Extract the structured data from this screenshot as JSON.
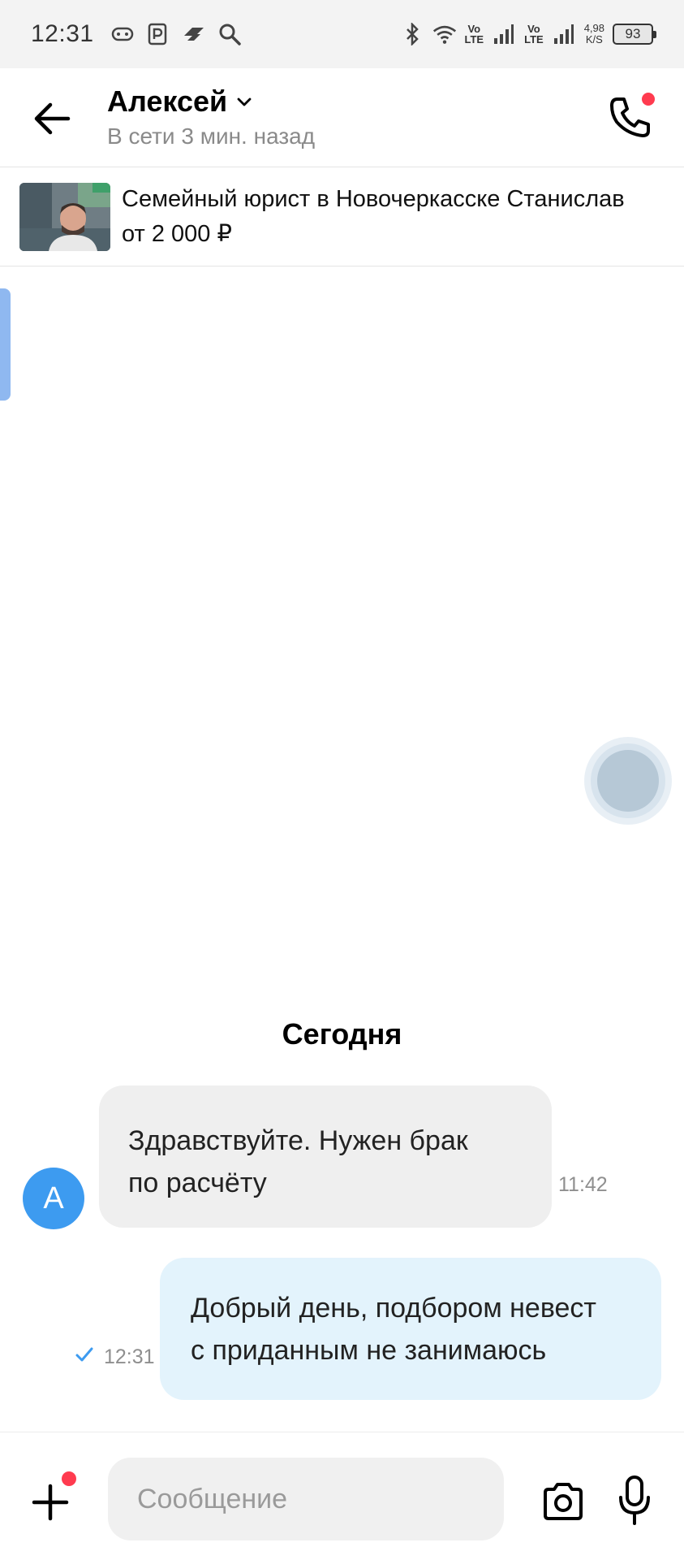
{
  "status_bar": {
    "time": "12:31",
    "network1": [
      "Vo",
      "LTE"
    ],
    "network2": [
      "Vo",
      "LTE"
    ],
    "speed_value": "4,98",
    "speed_unit": "K/S",
    "battery": "93"
  },
  "header": {
    "contact_name": "Алексей",
    "contact_status": "В сети 3 мин. назад"
  },
  "listing": {
    "title": "Семейный юрист в Новочеркасске Станислав",
    "price": "от 2 000 ₽"
  },
  "chat": {
    "date_separator": "Сегодня",
    "messages": [
      {
        "direction": "incoming",
        "avatar_letter": "А",
        "lines": [
          "Здравствуйте. Нужен брак",
          "по расчёту"
        ],
        "time": "11:42"
      },
      {
        "direction": "outgoing",
        "lines": [
          "Добрый день, подбором невест",
          "с приданным не занимаюсь"
        ],
        "time": "12:31",
        "status": "sent"
      }
    ]
  },
  "composer": {
    "placeholder": "Сообщение"
  },
  "colors": {
    "accent_blue": "#3d9bf0",
    "notification_dot": "#ff3b4f",
    "outgoing_bubble": "#e3f3fc",
    "incoming_bubble": "#efefef"
  },
  "icons": {
    "back": "arrow-left-icon",
    "call": "phone-icon",
    "chevron": "chevron-down-icon",
    "add": "plus-icon",
    "camera": "camera-icon",
    "mic": "microphone-icon",
    "check": "check-icon"
  }
}
